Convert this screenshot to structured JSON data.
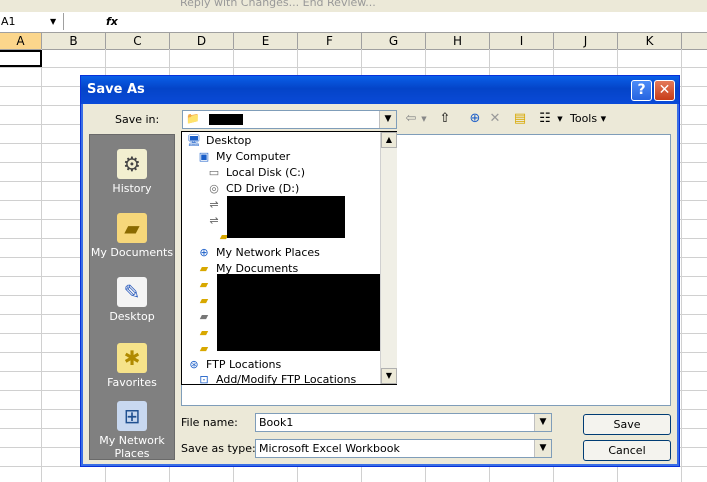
{
  "excel": {
    "toolbar_text": "Reply with Changes...   End Review...",
    "name_box": "A1",
    "fx_label": "fx",
    "columns": [
      "A",
      "B",
      "C",
      "D",
      "E",
      "F",
      "G",
      "H",
      "I",
      "J",
      "K"
    ]
  },
  "dialog": {
    "title": "Save As",
    "help_label": "?",
    "close_label": "✕",
    "save_in_label": "Save in:",
    "tools_label": "Tools",
    "places": [
      {
        "label": "History",
        "icon": "history-icon"
      },
      {
        "label": "My Documents",
        "icon": "my-documents-icon"
      },
      {
        "label": "Desktop",
        "icon": "desktop-icon"
      },
      {
        "label": "Favorites",
        "icon": "favorites-icon"
      },
      {
        "label": "My Network Places",
        "icon": "network-places-icon"
      }
    ],
    "dropdown_items": [
      {
        "label": "Desktop",
        "icon": "desktop-icon"
      },
      {
        "label": "My Computer",
        "icon": "computer-icon"
      },
      {
        "label": "Local Disk (C:)",
        "icon": "hard-disk-icon"
      },
      {
        "label": "CD Drive (D:)",
        "icon": "cd-drive-icon"
      },
      {
        "label": "My Network Places",
        "icon": "network-places-icon"
      },
      {
        "label": "My Documents",
        "icon": "my-documents-icon"
      },
      {
        "label": "FTP Locations",
        "icon": "ftp-icon"
      },
      {
        "label": "Add/Modify FTP Locations",
        "icon": "ftp-add-icon"
      }
    ],
    "file_name_label": "File name:",
    "file_name_value": "Book1",
    "save_as_type_label": "Save as type:",
    "save_as_type_value": "Microsoft Excel Workbook",
    "save_button": "Save",
    "cancel_button": "Cancel"
  }
}
